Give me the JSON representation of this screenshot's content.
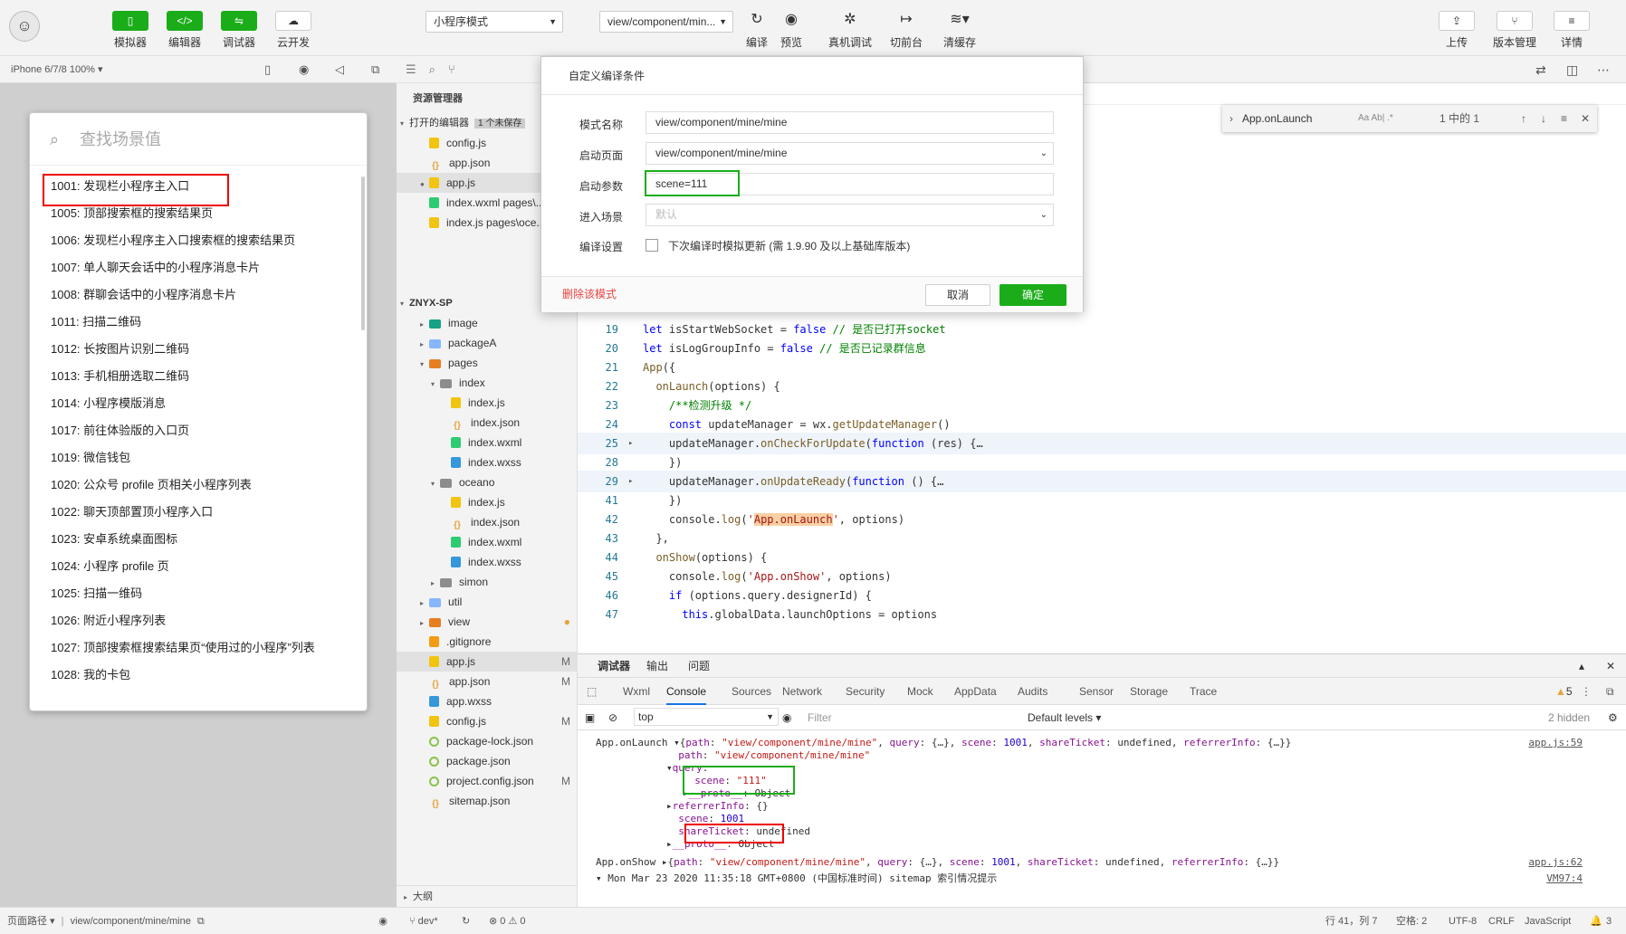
{
  "toolbar": {
    "left_buttons": [
      "模拟器",
      "编辑器",
      "调试器",
      "云开发"
    ],
    "mode_select": "小程序模式",
    "compile_select": "view/component/min...",
    "right_buttons": [
      "编译",
      "预览",
      "真机调试",
      "切前台",
      "清缓存"
    ],
    "far_right_buttons": [
      "上传",
      "版本管理",
      "详情"
    ]
  },
  "simulator": {
    "device": "iPhone 6/7/8 100% ▾",
    "search_placeholder": "查找场景值",
    "scenes": [
      "1001: 发现栏小程序主入口",
      "1005: 顶部搜索框的搜索结果页",
      "1006: 发现栏小程序主入口搜索框的搜索结果页",
      "1007: 单人聊天会话中的小程序消息卡片",
      "1008: 群聊会话中的小程序消息卡片",
      "1011: 扫描二维码",
      "1012: 长按图片识别二维码",
      "1013: 手机相册选取二维码",
      "1014: 小程序模版消息",
      "1017: 前往体验版的入口页",
      "1019: 微信钱包",
      "1020: 公众号 profile 页相关小程序列表",
      "1022: 聊天顶部置顶小程序入口",
      "1023: 安卓系统桌面图标",
      "1024: 小程序 profile 页",
      "1025: 扫描一维码",
      "1026: 附近小程序列表",
      "1027: 顶部搜索框搜索结果页“使用过的小程序”列表",
      "1028: 我的卡包"
    ],
    "footer_label": "页面路径 ▾",
    "footer_path": "view/component/mine/mine"
  },
  "explorer": {
    "title": "资源管理器",
    "open_editors": "打开的编辑器",
    "unsaved_badge": "1 个未保存",
    "project": "ZNYX-SP",
    "outline": "大纲",
    "rows": [
      {
        "name": "config.js",
        "type": "js",
        "indent": 1,
        "badge": ""
      },
      {
        "name": "app.json",
        "type": "json",
        "indent": 1,
        "badge": ""
      },
      {
        "name": "app.js",
        "type": "js",
        "indent": 1,
        "badge": ""
      },
      {
        "name": "index.wxml  pages\\...",
        "type": "wxml",
        "indent": 1,
        "badge": ""
      },
      {
        "name": "index.js  pages\\oce...",
        "type": "js",
        "indent": 1,
        "badge": ""
      },
      {
        "name": "image",
        "type": "folder",
        "indent": 1,
        "badge": ""
      },
      {
        "name": "packageA",
        "type": "folder",
        "indent": 1,
        "badge": ""
      },
      {
        "name": "pages",
        "type": "folder",
        "indent": 1,
        "badge": ""
      },
      {
        "name": "index",
        "type": "folder",
        "indent": 2,
        "badge": ""
      },
      {
        "name": "index.js",
        "type": "js",
        "indent": 3,
        "badge": ""
      },
      {
        "name": "index.json",
        "type": "json",
        "indent": 3,
        "badge": ""
      },
      {
        "name": "index.wxml",
        "type": "wxml",
        "indent": 3,
        "badge": ""
      },
      {
        "name": "index.wxss",
        "type": "wxss",
        "indent": 3,
        "badge": ""
      },
      {
        "name": "oceano",
        "type": "folder",
        "indent": 2,
        "badge": ""
      },
      {
        "name": "index.js",
        "type": "js",
        "indent": 3,
        "badge": ""
      },
      {
        "name": "index.json",
        "type": "json",
        "indent": 3,
        "badge": ""
      },
      {
        "name": "index.wxml",
        "type": "wxml",
        "indent": 3,
        "badge": ""
      },
      {
        "name": "index.wxss",
        "type": "wxss",
        "indent": 3,
        "badge": ""
      },
      {
        "name": "simon",
        "type": "folder",
        "indent": 2,
        "badge": ""
      },
      {
        "name": "util",
        "type": "folder",
        "indent": 1,
        "badge": ""
      },
      {
        "name": "view",
        "type": "folder",
        "indent": 1,
        "badge": "●"
      },
      {
        "name": ".gitignore",
        "type": "cfg",
        "indent": 1,
        "badge": ""
      },
      {
        "name": "app.js",
        "type": "js",
        "indent": 1,
        "badge": "M"
      },
      {
        "name": "app.json",
        "type": "json",
        "indent": 1,
        "badge": "M"
      },
      {
        "name": "app.wxss",
        "type": "wxss",
        "indent": 1,
        "badge": ""
      },
      {
        "name": "config.js",
        "type": "js",
        "indent": 1,
        "badge": "M"
      },
      {
        "name": "package-lock.json",
        "type": "pk",
        "indent": 1,
        "badge": ""
      },
      {
        "name": "package.json",
        "type": "pk",
        "indent": 1,
        "badge": ""
      },
      {
        "name": "project.config.json",
        "type": "pk",
        "indent": 1,
        "badge": "M"
      },
      {
        "name": "sitemap.json",
        "type": "json",
        "indent": 1,
        "badge": ""
      }
    ]
  },
  "find_widget": {
    "query": "App.onLaunch",
    "options": "Aa  Ab|  .*",
    "result": "1 中的 1"
  },
  "dialog": {
    "title": "自定义编译条件",
    "mode_name_label": "模式名称",
    "mode_name_value": "view/component/mine/mine",
    "start_page_label": "启动页面",
    "start_page_value": "view/component/mine/mine",
    "start_params_label": "启动参数",
    "start_params_value": "scene=111",
    "enter_scene_label": "进入场景",
    "enter_scene_placeholder": "默认",
    "compile_settings_label": "编译设置",
    "checkbox_label": "下次编译时模拟更新 (需 1.9.90 及以上基础库版本)",
    "delete_button": "删除该模式",
    "cancel_button": "取消",
    "ok_button": "确定"
  },
  "code": [
    {
      "ln": "19",
      "fold": "",
      "html": "<span class='kw'>let</span> isStartWebSocket = <span class='kw'>false</span> <span class='cm'>// 是否已打开socket</span>"
    },
    {
      "ln": "20",
      "fold": "",
      "html": "<span class='kw'>let</span> isLogGroupInfo = <span class='kw'>false</span> <span class='cm'>// 是否已记录群信息</span>"
    },
    {
      "ln": "21",
      "fold": "",
      "html": "<span class='fn'>App</span>({"
    },
    {
      "ln": "22",
      "fold": "",
      "html": "  <span class='fn'>onLaunch</span>(options) {"
    },
    {
      "ln": "23",
      "fold": "",
      "html": "    <span class='cm'>/**检测升级 */</span>"
    },
    {
      "ln": "24",
      "fold": "",
      "html": "    <span class='kw'>const</span> updateManager = wx.<span class='fn'>getUpdateManager</span>()"
    },
    {
      "ln": "25",
      "fold": "▸",
      "html": "    updateManager.<span class='fn'>onCheckForUpdate</span>(<span class='kw'>function</span> (res) {…"
    },
    {
      "ln": "28",
      "fold": "",
      "html": "    })"
    },
    {
      "ln": "29",
      "fold": "▸",
      "html": "    updateManager.<span class='fn'>onUpdateReady</span>(<span class='kw'>function</span> () {…"
    },
    {
      "ln": "41",
      "fold": "",
      "html": "    })"
    },
    {
      "ln": "42",
      "fold": "",
      "html": "    console.<span class='fn'>log</span>(<span class='str'>'<span class=\"st-hl\">App.onLaunch</span>'</span>, options)"
    },
    {
      "ln": "43",
      "fold": "",
      "html": "  },"
    },
    {
      "ln": "44",
      "fold": "",
      "html": "  <span class='fn'>onShow</span>(options) {"
    },
    {
      "ln": "45",
      "fold": "",
      "html": "    console.<span class='fn'>log</span>(<span class='str'>'App.onShow'</span>, options)"
    },
    {
      "ln": "46",
      "fold": "",
      "html": "    <span class='kw'>if</span> (options.query.designerId) {"
    },
    {
      "ln": "47",
      "fold": "",
      "html": "      <span class='kw'>this</span>.globalData.launchOptions = options"
    }
  ],
  "devtools": {
    "top_tabs": [
      "调试器",
      "输出",
      "问题"
    ],
    "tabs": [
      "Wxml",
      "Console",
      "Sources",
      "Network",
      "Security",
      "Mock",
      "AppData",
      "Audits",
      "Sensor",
      "Storage",
      "Trace"
    ],
    "warning_count": "5",
    "context": "top",
    "filter_placeholder": "Filter",
    "levels": "Default levels ▾",
    "hidden": "2 hidden",
    "console": [
      {
        "indent": 0,
        "html": "App.onLaunch ▾{<span class='c-key'>path</span>: <span class='c-str'>\"view/component/mine/mine\"</span>, <span class='c-key'>query</span>: {…}, <span class='c-key'>scene</span>: <span class='c-num'>1001</span>, <span class='c-key'>shareTicket</span>: undefined, <span class='c-key'>referrerInfo</span>: {…}}",
        "link": "app.js:59"
      },
      {
        "indent": 1,
        "html": "  <span class='c-key'>path</span>: <span class='c-str'>\"view/component/mine/mine\"</span>",
        "link": ""
      },
      {
        "indent": 1,
        "html": "▾<span class='c-key'>query</span>:",
        "link": ""
      },
      {
        "indent": 2,
        "html": "  <span class='c-key'>scene</span>: <span class='c-str'>\"111\"</span>",
        "link": ""
      },
      {
        "indent": 2,
        "html": "▸<span class='c-key'>__proto__</span>: Object",
        "link": ""
      },
      {
        "indent": 1,
        "html": "▸<span class='c-key'>referrerInfo</span>: {}",
        "link": ""
      },
      {
        "indent": 1,
        "html": "  <span class='c-key'>scene</span>: <span class='c-num'>1001</span>",
        "link": ""
      },
      {
        "indent": 1,
        "html": "  <span class='c-key'>shareTicket</span>: undefined",
        "link": ""
      },
      {
        "indent": 1,
        "html": "▸<span class='c-key'>__proto__</span>: Object",
        "link": ""
      },
      {
        "indent": 0,
        "html": "App.onShow ▸{<span class='c-key'>path</span>: <span class='c-str'>\"view/component/mine/mine\"</span>, <span class='c-key'>query</span>: {…}, <span class='c-key'>scene</span>: <span class='c-num'>1001</span>, <span class='c-key'>shareTicket</span>: undefined, <span class='c-key'>referrerInfo</span>: {…}}",
        "link": "app.js:62"
      },
      {
        "indent": 0,
        "html": "▾ Mon Mar 23 2020 11:35:18 GMT+0800 (中国标准时间) sitemap 索引情况提示",
        "link": "VM97:4"
      }
    ]
  },
  "statusbar": {
    "branch": "dev*",
    "errors": "⊗ 0 ⚠ 0",
    "position": "行 41，列 7",
    "spaces": "空格: 2",
    "encoding": "UTF-8",
    "eol": "CRLF",
    "language": "JavaScript",
    "notifications": "3"
  },
  "colors": {
    "accent": "#1aad19",
    "highlight_red": "#e00000",
    "highlight_green": "#1aad19"
  }
}
